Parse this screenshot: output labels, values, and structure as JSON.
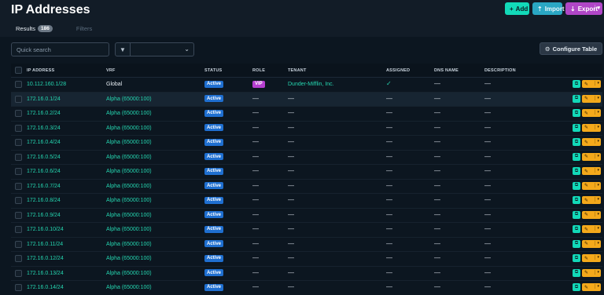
{
  "header": {
    "title": "IP Addresses",
    "actions": {
      "add_label": "Add",
      "import_label": "Import",
      "export_label": "Export"
    }
  },
  "tabs": [
    {
      "label": "Results",
      "count": "186",
      "active": true
    },
    {
      "label": "Filters",
      "active": false
    }
  ],
  "toolbar": {
    "search_placeholder": "Quick search",
    "configure_label": "Configure Table"
  },
  "columns": [
    "IP ADDRESS",
    "VRF",
    "STATUS",
    "ROLE",
    "TENANT",
    "ASSIGNED",
    "DNS NAME",
    "DESCRIPTION"
  ],
  "rows": [
    {
      "ip": "10.112.160.1/28",
      "vrf": "Global",
      "status": "Active",
      "role": "VIP",
      "tenant": "Dunder-Mifflin, Inc.",
      "assigned": "✓",
      "dns": "—",
      "description": "—"
    },
    {
      "ip": "172.16.0.1/24",
      "vrf": "Alpha (65000:100)",
      "status": "Active",
      "role": "—",
      "tenant": "—",
      "assigned": "—",
      "dns": "—",
      "description": "—"
    },
    {
      "ip": "172.16.0.2/24",
      "vrf": "Alpha (65000:100)",
      "status": "Active",
      "role": "—",
      "tenant": "—",
      "assigned": "—",
      "dns": "—",
      "description": "—"
    },
    {
      "ip": "172.16.0.3/24",
      "vrf": "Alpha (65000:100)",
      "status": "Active",
      "role": "—",
      "tenant": "—",
      "assigned": "—",
      "dns": "—",
      "description": "—"
    },
    {
      "ip": "172.16.0.4/24",
      "vrf": "Alpha (65000:100)",
      "status": "Active",
      "role": "—",
      "tenant": "—",
      "assigned": "—",
      "dns": "—",
      "description": "—"
    },
    {
      "ip": "172.16.0.5/24",
      "vrf": "Alpha (65000:100)",
      "status": "Active",
      "role": "—",
      "tenant": "—",
      "assigned": "—",
      "dns": "—",
      "description": "—"
    },
    {
      "ip": "172.16.0.6/24",
      "vrf": "Alpha (65000:100)",
      "status": "Active",
      "role": "—",
      "tenant": "—",
      "assigned": "—",
      "dns": "—",
      "description": "—"
    },
    {
      "ip": "172.16.0.7/24",
      "vrf": "Alpha (65000:100)",
      "status": "Active",
      "role": "—",
      "tenant": "—",
      "assigned": "—",
      "dns": "—",
      "description": "—"
    },
    {
      "ip": "172.16.0.8/24",
      "vrf": "Alpha (65000:100)",
      "status": "Active",
      "role": "—",
      "tenant": "—",
      "assigned": "—",
      "dns": "—",
      "description": "—"
    },
    {
      "ip": "172.16.0.9/24",
      "vrf": "Alpha (65000:100)",
      "status": "Active",
      "role": "—",
      "tenant": "—",
      "assigned": "—",
      "dns": "—",
      "description": "—"
    },
    {
      "ip": "172.16.0.10/24",
      "vrf": "Alpha (65000:100)",
      "status": "Active",
      "role": "—",
      "tenant": "—",
      "assigned": "—",
      "dns": "—",
      "description": "—"
    },
    {
      "ip": "172.16.0.11/24",
      "vrf": "Alpha (65000:100)",
      "status": "Active",
      "role": "—",
      "tenant": "—",
      "assigned": "—",
      "dns": "—",
      "description": "—"
    },
    {
      "ip": "172.16.0.12/24",
      "vrf": "Alpha (65000:100)",
      "status": "Active",
      "role": "—",
      "tenant": "—",
      "assigned": "—",
      "dns": "—",
      "description": "—"
    },
    {
      "ip": "172.16.0.13/24",
      "vrf": "Alpha (65000:100)",
      "status": "Active",
      "role": "—",
      "tenant": "—",
      "assigned": "—",
      "dns": "—",
      "description": "—"
    },
    {
      "ip": "172.16.0.14/24",
      "vrf": "Alpha (65000:100)",
      "status": "Active",
      "role": "—",
      "tenant": "—",
      "assigned": "—",
      "dns": "—",
      "description": "—"
    }
  ],
  "colors": {
    "accent": "#25d6b0",
    "status_active": "#1f6fd0",
    "role_vip": "#b63fd0",
    "edit_button": "#f4a91b",
    "export_button": "#b046c7"
  }
}
